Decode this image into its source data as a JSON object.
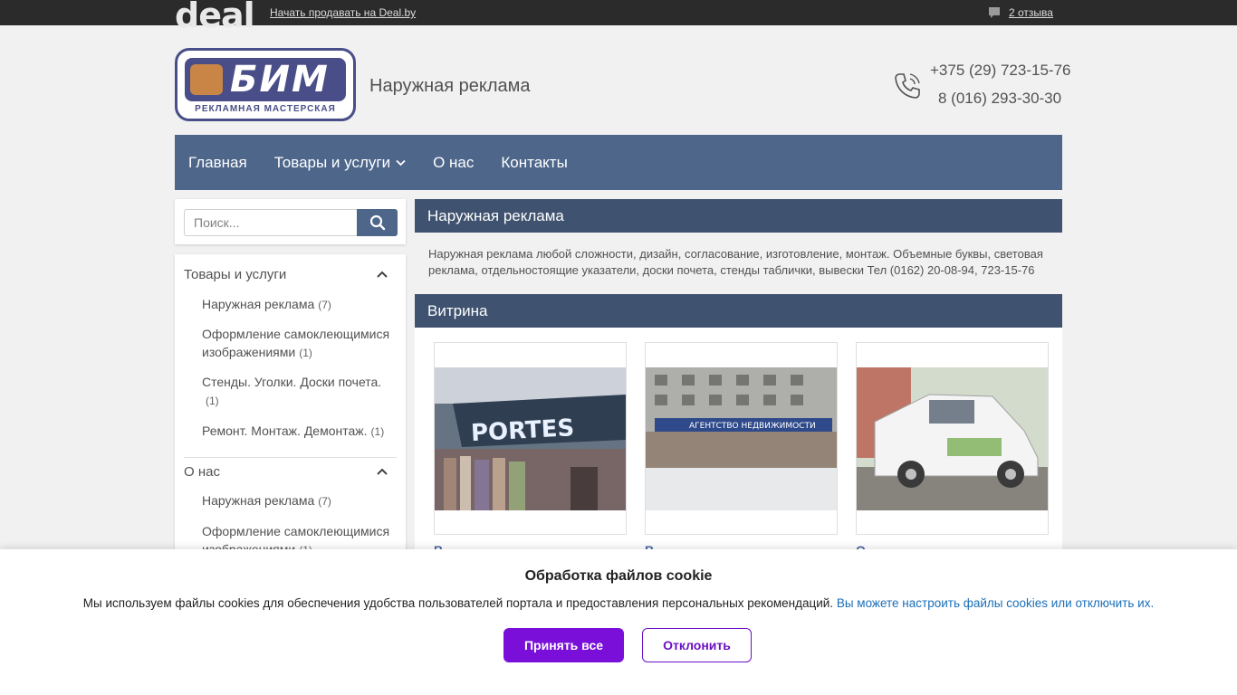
{
  "topbar": {
    "logo": "deal",
    "sell_link": "Начать продавать на Deal.by",
    "reviews": "2 отзыва"
  },
  "header": {
    "logo_main": "БИМ",
    "logo_sub": "РЕКЛАМНАЯ МАСТЕРСКАЯ",
    "title": "Наружная реклама",
    "phone1": "+375 (29) 723-15-76",
    "phone2": "8 (016) 293-30-30"
  },
  "nav": {
    "items": [
      "Главная",
      "Товары и услуги",
      "О нас",
      "Контакты"
    ]
  },
  "search": {
    "placeholder": "Поиск..."
  },
  "sidebar": {
    "sections": [
      {
        "title": "Товары и услуги",
        "items": [
          {
            "label": "Наружная реклама",
            "count": "(7)"
          },
          {
            "label": "Оформление самоклеющимися изображениями",
            "count": "(1)"
          },
          {
            "label": "Стенды. Уголки. Доски почета.",
            "count": "(1)"
          },
          {
            "label": "Ремонт. Монтаж. Демонтаж.",
            "count": "(1)"
          }
        ]
      },
      {
        "title": "О нас",
        "items": [
          {
            "label": "Наружная реклама",
            "count": "(7)"
          },
          {
            "label": "Оформление самоклеющимися изображениями",
            "count": "(1)"
          }
        ]
      }
    ]
  },
  "main": {
    "heading": "Наружная реклама",
    "description": "Наружная реклама любой сложности, дизайн, согласование, изготовление, монтаж. Объемные буквы, световая реклама, отдельностоящие указатели, доски почета, стенды таблички, вывески Тел (0162) 20-08-94, 723-15-76",
    "showcase_heading": "Витрина",
    "cards": [
      {
        "sign": "PORTES",
        "title": "В"
      },
      {
        "sign": "АГЕНТСТВО НЕДВИЖИМОСТИ",
        "title": "В"
      },
      {
        "sign": "",
        "title": "О"
      }
    ]
  },
  "cookie": {
    "title": "Обработка файлов cookie",
    "text": "Мы используем файлы cookies для обеспечения удобства пользователей портала и предоставления персональных рекомендаций.",
    "link": "Вы можете настроить файлы cookies или отключить их.",
    "accept": "Принять все",
    "decline": "Отклонить"
  },
  "colors": {
    "nav": "#3e5a80",
    "panel_head": "#2f4463",
    "accent_button": "#7a0fd9",
    "link": "#1a6fb8"
  }
}
